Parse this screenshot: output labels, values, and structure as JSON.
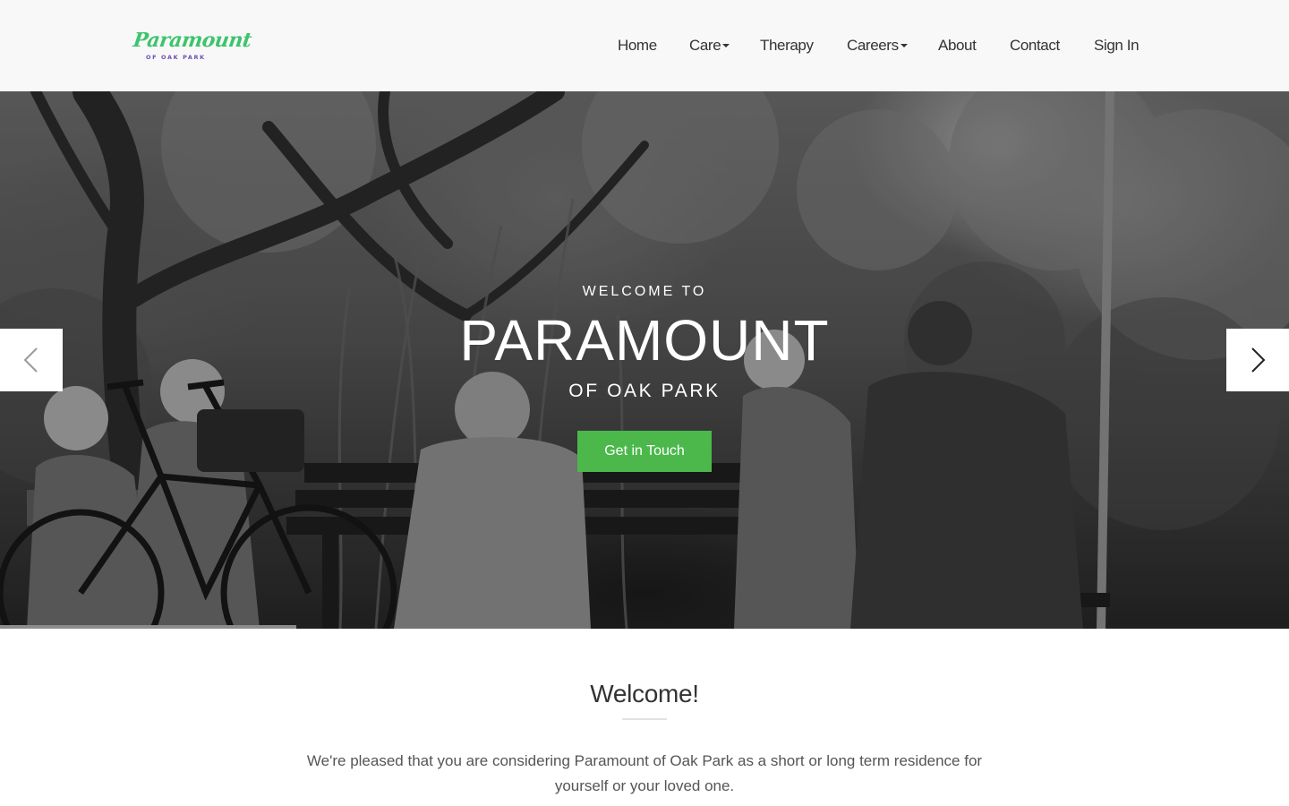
{
  "brand": {
    "name": "Paramount",
    "subtitle": "OF OAK PARK",
    "colors": {
      "script": "#3ec46d",
      "subtitle": "#6c4fb6"
    }
  },
  "nav": {
    "items": [
      {
        "label": "Home",
        "has_dropdown": false
      },
      {
        "label": "Care",
        "has_dropdown": true
      },
      {
        "label": "Therapy",
        "has_dropdown": false
      },
      {
        "label": "Careers",
        "has_dropdown": true
      },
      {
        "label": "About",
        "has_dropdown": false
      },
      {
        "label": "Contact",
        "has_dropdown": false
      },
      {
        "label": "Sign In",
        "has_dropdown": false
      }
    ]
  },
  "hero": {
    "kicker": "WELCOME TO",
    "title": "PARAMOUNT",
    "subtitle": "OF OAK PARK",
    "cta_label": "Get in Touch",
    "prev_icon": "chevron-left-icon",
    "next_icon": "chevron-right-icon",
    "slide_progress": 0.23,
    "colors": {
      "cta": "#4cb84c"
    }
  },
  "welcome": {
    "heading": "Welcome!",
    "text": "We're pleased that you are considering Paramount of Oak Park as a short or long term residence for yourself or your loved one."
  }
}
